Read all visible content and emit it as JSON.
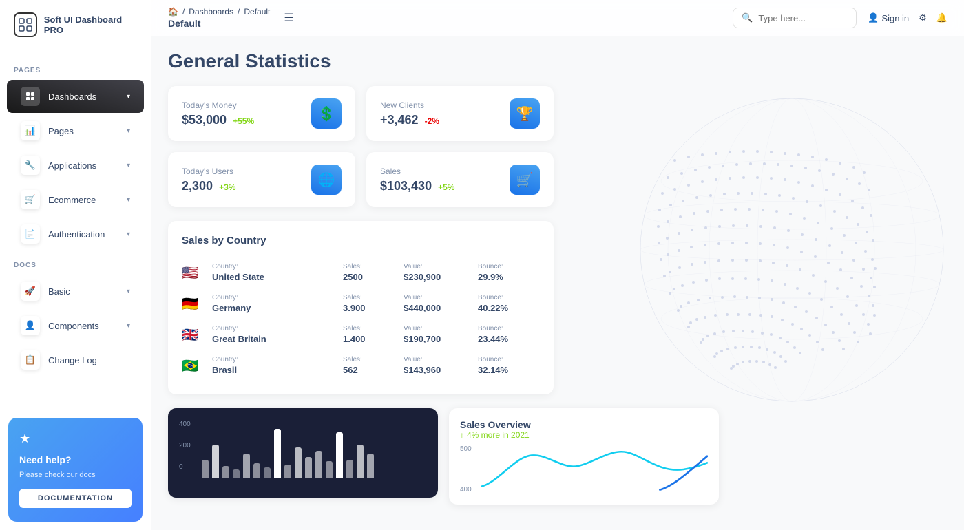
{
  "sidebar": {
    "logo_icon": "⊞",
    "logo_text": "Soft UI Dashboard PRO",
    "pages_label": "PAGES",
    "docs_label": "DOCS",
    "nav_items_pages": [
      {
        "id": "dashboards",
        "label": "Dashboards",
        "icon": "⊡",
        "active": true,
        "has_arrow": true
      },
      {
        "id": "pages",
        "label": "Pages",
        "icon": "📊",
        "active": false,
        "has_arrow": true
      },
      {
        "id": "applications",
        "label": "Applications",
        "icon": "🔧",
        "active": false,
        "has_arrow": true
      },
      {
        "id": "ecommerce",
        "label": "Ecommerce",
        "icon": "🛒",
        "active": false,
        "has_arrow": true
      },
      {
        "id": "authentication",
        "label": "Authentication",
        "icon": "📄",
        "active": false,
        "has_arrow": true
      }
    ],
    "nav_items_docs": [
      {
        "id": "basic",
        "label": "Basic",
        "icon": "🚀",
        "active": false,
        "has_arrow": true
      },
      {
        "id": "components",
        "label": "Components",
        "icon": "👤",
        "active": false,
        "has_arrow": true
      },
      {
        "id": "changelog",
        "label": "Change Log",
        "icon": "📋",
        "active": false,
        "has_arrow": false
      }
    ],
    "help": {
      "star": "★",
      "title": "Need help?",
      "subtitle": "Please check our docs",
      "btn_label": "DOCUMENTATION"
    }
  },
  "topbar": {
    "breadcrumb": [
      {
        "label": "🏠",
        "separator": "/"
      },
      {
        "label": "Dashboards",
        "separator": "/"
      },
      {
        "label": "Default",
        "separator": ""
      }
    ],
    "page_title": "Default",
    "search_placeholder": "Type here...",
    "actions": [
      {
        "id": "signin",
        "icon": "👤",
        "label": "Sign in"
      },
      {
        "id": "settings",
        "icon": "⚙",
        "label": ""
      },
      {
        "id": "notifications",
        "icon": "🔔",
        "label": ""
      }
    ],
    "hamburger": "☰"
  },
  "main": {
    "page_title": "General Statistics",
    "stats": [
      {
        "id": "money",
        "label": "Today's Money",
        "value": "$53,000",
        "change": "+55%",
        "change_type": "up",
        "icon": "💲"
      },
      {
        "id": "clients",
        "label": "New Clients",
        "value": "+3,462",
        "change": "-2%",
        "change_type": "down",
        "icon": "🏆"
      },
      {
        "id": "users",
        "label": "Today's Users",
        "value": "2,300",
        "change": "+3%",
        "change_type": "up",
        "icon": "🌐"
      },
      {
        "id": "sales",
        "label": "Sales",
        "value": "$103,430",
        "change": "+5%",
        "change_type": "up",
        "icon": "🛒"
      }
    ],
    "sales_by_country": {
      "title": "Sales by Country",
      "columns": [
        "Country:",
        "Sales:",
        "Value:",
        "Bounce:"
      ],
      "rows": [
        {
          "flag": "🇺🇸",
          "country": "United State",
          "sales": "2500",
          "value": "$230,900",
          "bounce": "29.9%"
        },
        {
          "flag": "🇩🇪",
          "country": "Germany",
          "sales": "3.900",
          "value": "$440,000",
          "bounce": "40.22%"
        },
        {
          "flag": "🇬🇧",
          "country": "Great Britain",
          "sales": "1.400",
          "value": "$190,700",
          "bounce": "23.44%"
        },
        {
          "flag": "🇧🇷",
          "country": "Brasil",
          "sales": "562",
          "value": "$143,960",
          "bounce": "32.14%"
        }
      ]
    },
    "bar_chart": {
      "labels": [
        "400",
        "200",
        "0"
      ],
      "bars": [
        30,
        55,
        20,
        15,
        40,
        25,
        18,
        60,
        22,
        50,
        35,
        45,
        28,
        62,
        30,
        55,
        40
      ]
    },
    "sales_overview": {
      "title": "Sales Overview",
      "trend": "4% more in 2021",
      "trend_icon": "↑",
      "chart_labels": [
        "500",
        "400"
      ]
    }
  }
}
